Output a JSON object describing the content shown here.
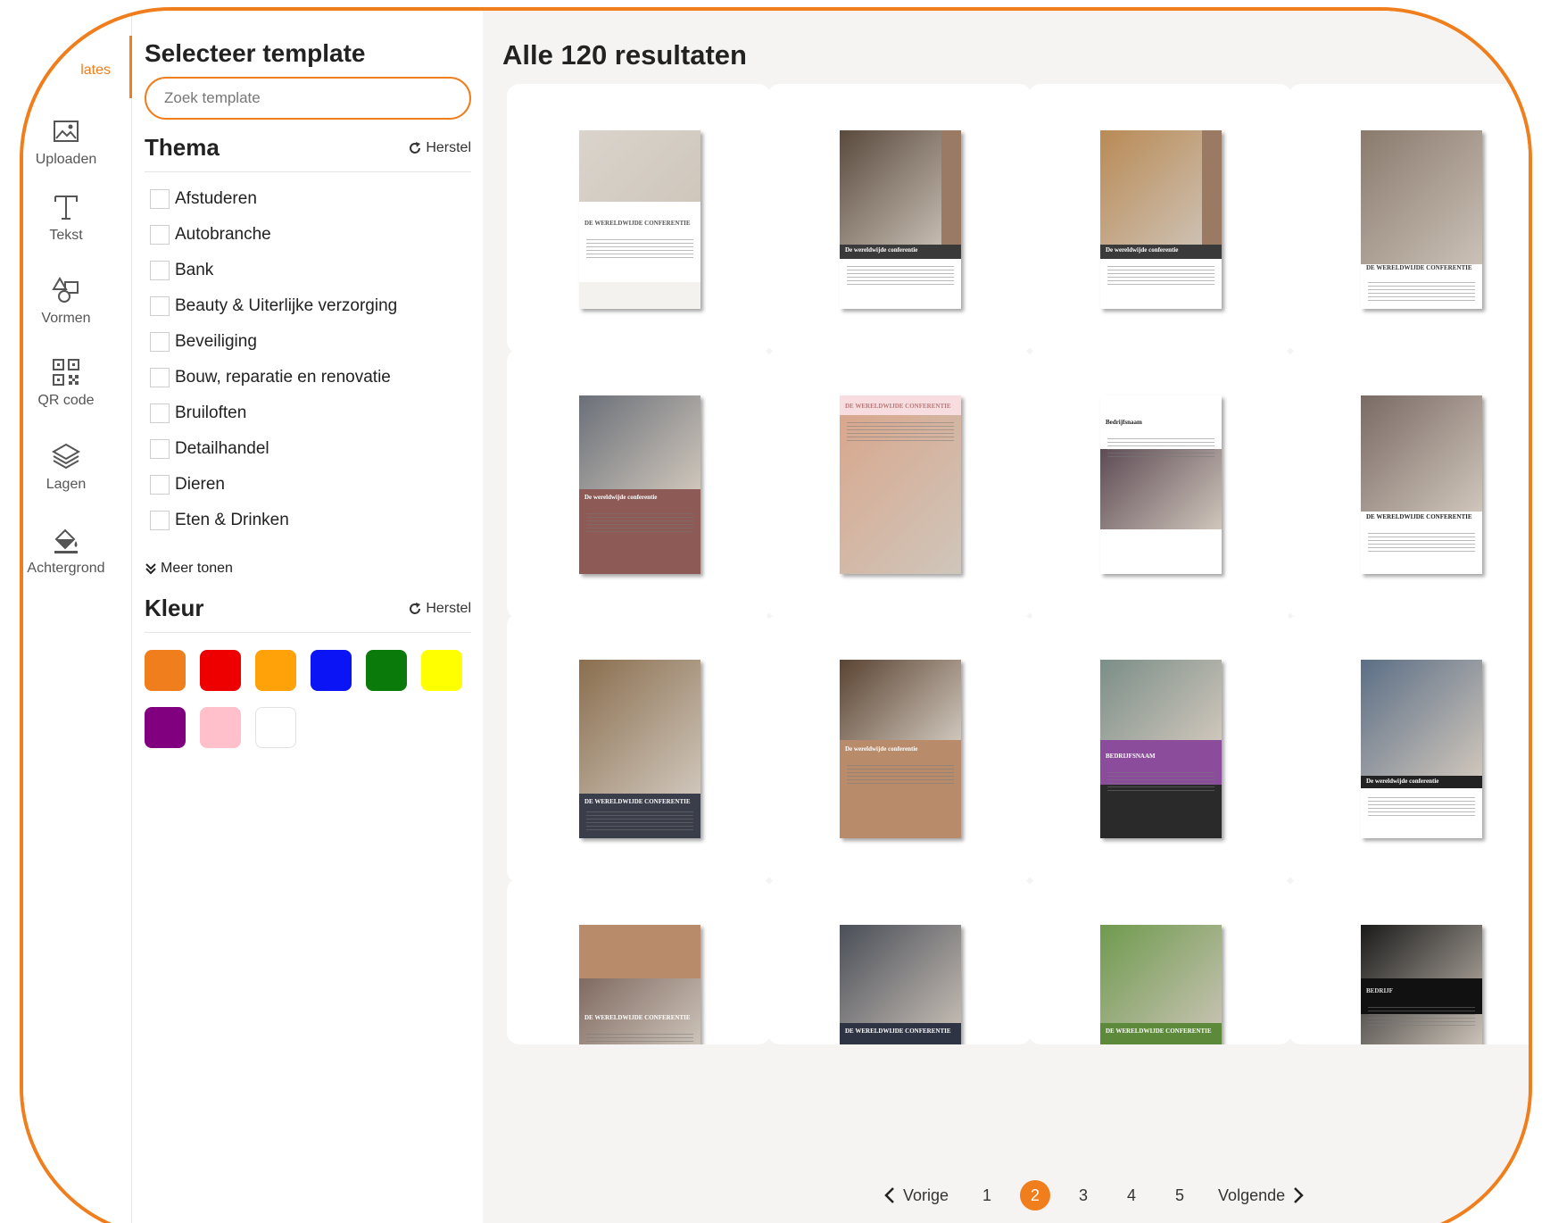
{
  "rail": {
    "items": [
      {
        "label": "lates",
        "icon": "templates-icon"
      },
      {
        "label": "Uploaden",
        "icon": "image-icon"
      },
      {
        "label": "Tekst",
        "icon": "text-icon"
      },
      {
        "label": "Vormen",
        "icon": "shapes-icon"
      },
      {
        "label": "QR code",
        "icon": "qr-code-icon"
      },
      {
        "label": "Lagen",
        "icon": "layers-icon"
      },
      {
        "label": "Achtergrond",
        "icon": "paint-bucket-icon"
      }
    ]
  },
  "panel": {
    "title": "Selecteer template",
    "search_placeholder": "Zoek template",
    "theme_heading": "Thema",
    "reset_label": "Herstel",
    "themes": [
      "Afstuderen",
      "Autobranche",
      "Bank",
      "Beauty & Uiterlijke verzorging",
      "Beveiliging",
      "Bouw, reparatie en renovatie",
      "Bruiloften",
      "Detailhandel",
      "Dieren",
      "Eten & Drinken"
    ],
    "more_label": "Meer tonen",
    "color_heading": "Kleur",
    "color_reset_label": "Herstel",
    "colors": [
      "#f07e1c",
      "#ee0000",
      "#ffa20a",
      "#0a14f5",
      "#0a7a0a",
      "#ffff00",
      "#800080",
      "#ffc0cb",
      "#ffffff"
    ]
  },
  "main": {
    "title": "Alle 120 resultaten",
    "templates": [
      {
        "title": "DE WERELDWIJDE CONFERENTIE"
      },
      {
        "title": "De wereldwijde conferentie"
      },
      {
        "title": "De wereldwijde conferentie"
      },
      {
        "title": "DE WERELDWIJDE CONFERENTIE"
      },
      {
        "title": "De wereldwijde conferentie"
      },
      {
        "title": "DE WERELDWIJDE CONFERENTIE"
      },
      {
        "title": "Bedrijfsnaam"
      },
      {
        "title": "DE WERELDWIJDE CONFERENTIE"
      },
      {
        "title": "DE WERELDWIJDE CONFERENTIE"
      },
      {
        "title": "De wereldwijde conferentie"
      },
      {
        "title": "BEDRIJFSNAAM"
      },
      {
        "title": "De wereldwijde conferentie"
      },
      {
        "title": "DE WERELDWIJDE CONFERENTIE"
      },
      {
        "title": "DE WERELDWIJDE CONFERENTIE"
      },
      {
        "title": "DE WERELDWIJDE CONFERENTIE"
      },
      {
        "title": "BEDRIJF"
      }
    ]
  },
  "pager": {
    "prev_label": "Vorige",
    "pages": [
      "1",
      "2",
      "3",
      "4",
      "5"
    ],
    "current": "2",
    "next_label": "Volgende"
  }
}
